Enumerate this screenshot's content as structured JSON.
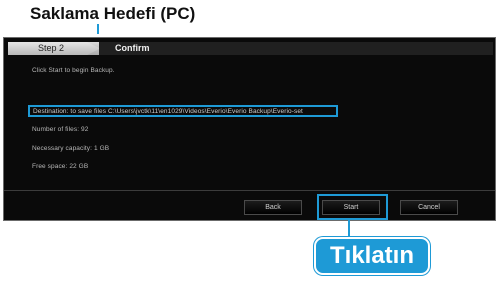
{
  "callouts": {
    "destination_title": "Saklama Hedefi (PC)",
    "click_label": "Tıklatın"
  },
  "wizard": {
    "step_label": "Step 2",
    "step_title": "Confirm",
    "intro_text": "Click Start to begin Backup.",
    "destination_text": "Destination: to save files C:\\Users\\jvctk\\11\\en1029\\Videos\\Everio\\Everio Backup\\Everio-set",
    "number_of_files": "Number of files: 92",
    "necessary_space": "Necessary capacity: 1 GB",
    "free_space": "Free space: 22 GB"
  },
  "buttons": {
    "back": "Back",
    "start": "Start",
    "cancel": "Cancel"
  },
  "colors": {
    "accent": "#1e9ad6",
    "panel_bg": "#0a0a0a",
    "text_dim": "#b8b8b8"
  }
}
